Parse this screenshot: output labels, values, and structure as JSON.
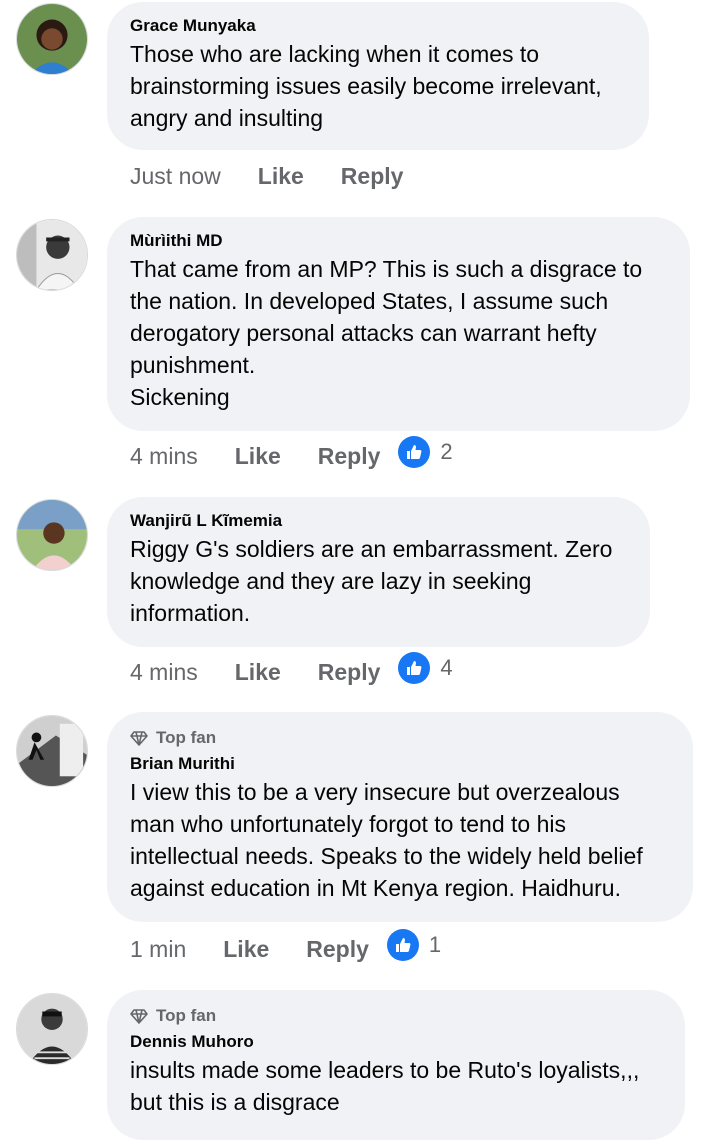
{
  "colors": {
    "bubble": "#f0f2f5",
    "secondary_text": "#65676b",
    "like_blue": "#1877f2"
  },
  "comments": [
    {
      "name": "Grace Munyaka",
      "top_fan": false,
      "text": "Those who are lacking when it comes to\nbrainstorming issues easily become irrelevant,\nangry and insulting",
      "time": "Just now",
      "like": "Like",
      "reply": "Reply",
      "reactions": null
    },
    {
      "name": "Mùrìithi MD",
      "top_fan": false,
      "text": "That came from an MP? This is such a disgrace to\nthe nation. In developed States, I assume such\nderogatory personal attacks can warrant hefty\npunishment.\nSickening",
      "time": "4 mins",
      "like": "Like",
      "reply": "Reply",
      "reactions": "2"
    },
    {
      "name": "Wanjirũ L Kĩmemia",
      "top_fan": false,
      "text": "Riggy G's soldiers are an embarrassment. Zero\nknowledge and they are lazy in seeking\ninformation.",
      "time": "4 mins",
      "like": "Like",
      "reply": "Reply",
      "reactions": "4"
    },
    {
      "name": "Brian Murithi",
      "top_fan": true,
      "badge": "Top fan",
      "text": "I view this to be a very insecure but overzealous\nman who unfortunately forgot to tend to his\nintellectual needs. Speaks to the widely held belief\nagainst education in Mt Kenya region.  Haidhuru.",
      "time": "1 min",
      "like": "Like",
      "reply": "Reply",
      "reactions": "1"
    },
    {
      "name": "Dennis Muhoro",
      "top_fan": true,
      "badge": "Top fan",
      "text": "insults made some leaders to be Ruto's loyalists,,,\nbut this is a disgrace",
      "time": null,
      "like": null,
      "reply": null,
      "reactions": null
    }
  ]
}
